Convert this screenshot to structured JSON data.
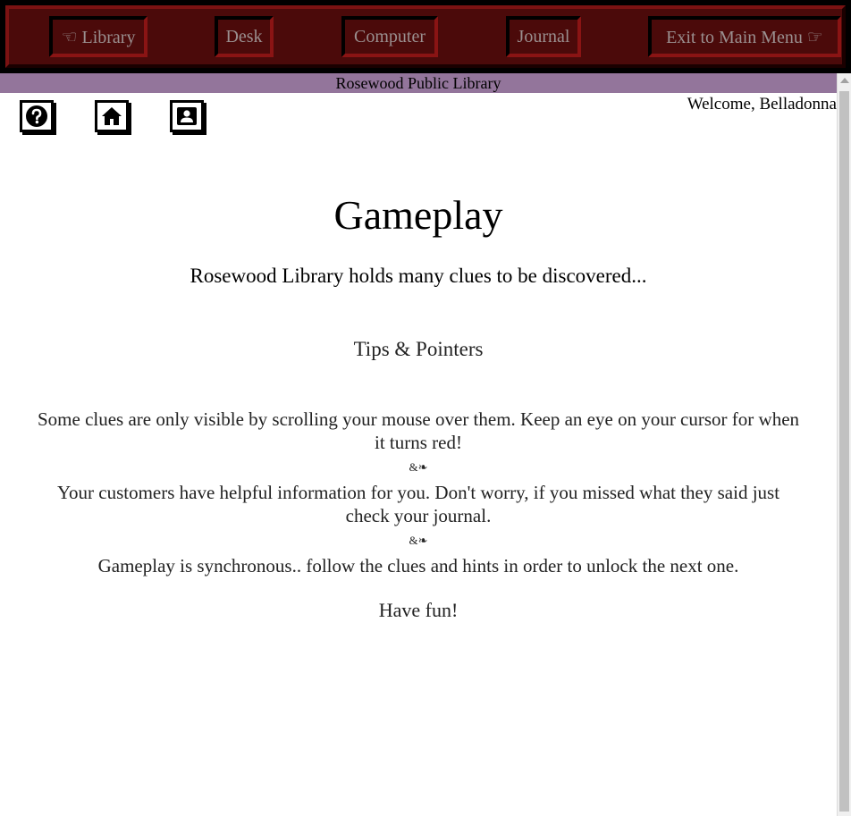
{
  "nav": {
    "library": "☜ Library",
    "desk": "Desk",
    "computer": "Computer",
    "journal": "Journal",
    "exit": "Exit to Main Menu ☞"
  },
  "banner": "Rosewood Public Library",
  "welcome": "Welcome, Belladonna",
  "icons": [
    "help-icon",
    "home-icon",
    "contact-card-icon"
  ],
  "page": {
    "title": "Gameplay",
    "subtitle": "Rosewood Library holds many clues to be discovered...",
    "tips_heading": "Tips & Pointers",
    "tips": [
      "Some clues are only visible by scrolling your mouse over them. Keep an eye on your cursor for when it turns red!",
      "Your customers have helpful information for you. Don't worry, if you missed what they said just check your journal.",
      "Gameplay is synchronous.. follow the clues and hints in order to unlock the next one."
    ],
    "separator": "&❧",
    "closing": "Have fun!"
  },
  "colors": {
    "nav_bg": "#4b0a0a",
    "nav_text": "#9a8f8f",
    "banner_bg": "#93759b"
  }
}
